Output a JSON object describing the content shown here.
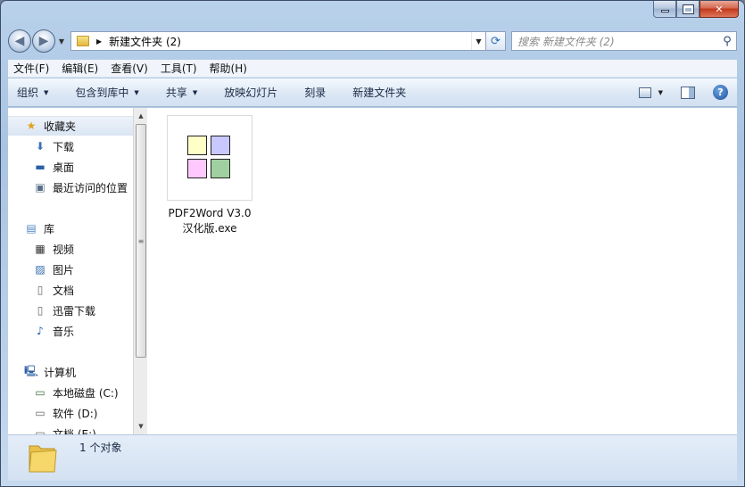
{
  "window": {
    "caption_buttons": {
      "minimize": "–",
      "maximize": "□",
      "close": "✕"
    }
  },
  "address": {
    "path": "新建文件夹 (2)",
    "search_placeholder": "搜索 新建文件夹 (2)"
  },
  "menu": [
    "文件(F)",
    "编辑(E)",
    "查看(V)",
    "工具(T)",
    "帮助(H)"
  ],
  "commands": [
    {
      "label": "组织",
      "dropdown": true
    },
    {
      "label": "包含到库中",
      "dropdown": true
    },
    {
      "label": "共享",
      "dropdown": true
    },
    {
      "label": "放映幻灯片",
      "dropdown": false
    },
    {
      "label": "刻录",
      "dropdown": false
    },
    {
      "label": "新建文件夹",
      "dropdown": false
    }
  ],
  "nav": {
    "favorites": {
      "label": "收藏夹",
      "items": [
        "下载",
        "桌面",
        "最近访问的位置"
      ]
    },
    "libraries": {
      "label": "库",
      "items": [
        "视频",
        "图片",
        "文档",
        "迅雷下载",
        "音乐"
      ]
    },
    "computer": {
      "label": "计算机",
      "items": [
        "本地磁盘 (C:)",
        "软件 (D:)",
        "文档 (E:)"
      ]
    }
  },
  "files": [
    {
      "name_line1": "PDF2Word V3.0",
      "name_line2": "汉化版.exe",
      "icon": "pdf2word-app-icon"
    }
  ],
  "status": {
    "count": "1 个对象"
  },
  "colors": {
    "page_yellow": "#ffffc8",
    "page_blue": "#c8c8ff",
    "page_pink": "#ffc8ff",
    "page_green": "#a0d0a0"
  }
}
